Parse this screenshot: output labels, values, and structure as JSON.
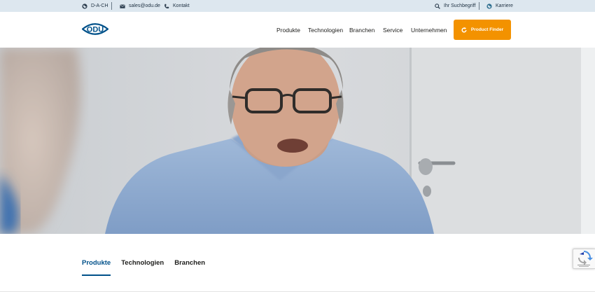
{
  "topbar": {
    "region_label": "D-A-CH",
    "email_label": "sales@odu.de",
    "contact_label": "Kontakt",
    "search_placeholder": "Ihr Suchbegriff",
    "career_label": "Karriere"
  },
  "header": {
    "logo_text": "ODU",
    "nav": [
      "Produkte",
      "Technologien",
      "Branchen",
      "Service",
      "Unternehmen"
    ],
    "finder_label": "Product Finder"
  },
  "tabs": {
    "items": [
      "Produkte",
      "Technologien",
      "Branchen"
    ],
    "active_index": 0
  },
  "colors": {
    "topbar_bg": "#dde7ef",
    "brand_blue": "#00518a",
    "accent_orange": "#f39200"
  },
  "icons": {
    "region": "globe-icon",
    "email": "envelope-icon",
    "contact": "phone-icon",
    "search": "search-icon",
    "career": "globe-icon",
    "finder": "refresh-icon",
    "captcha": "recaptcha-icon"
  }
}
